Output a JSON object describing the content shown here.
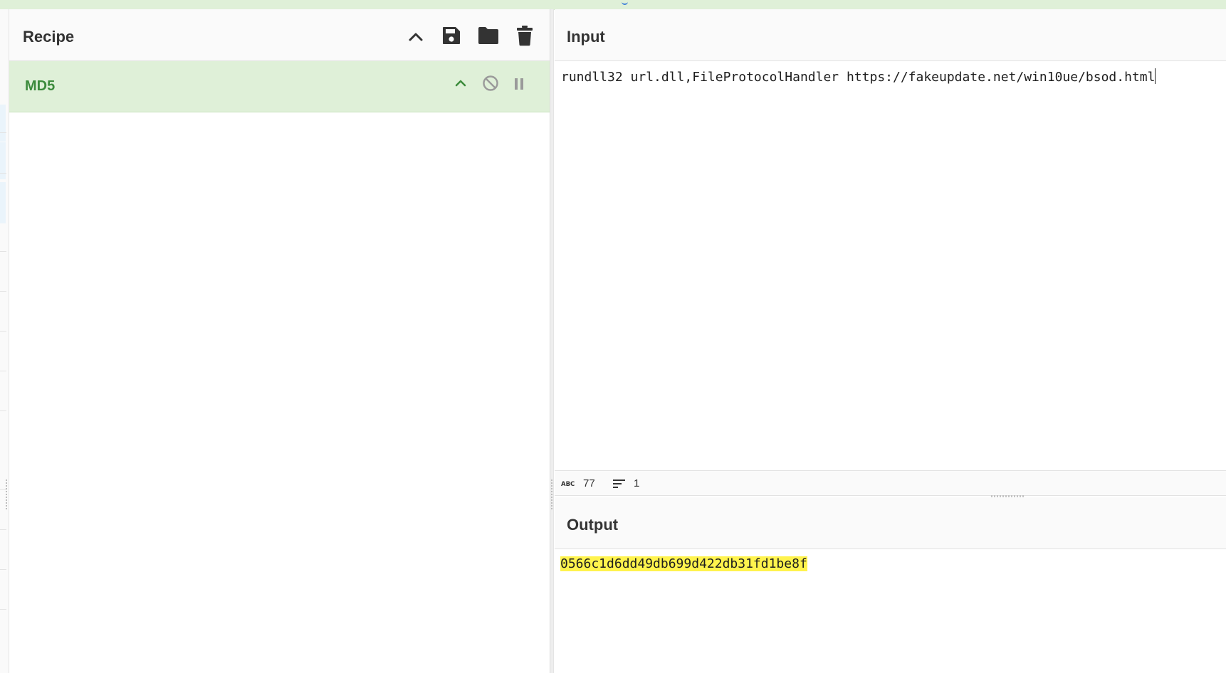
{
  "recipe": {
    "title": "Recipe",
    "operations": [
      {
        "name": "MD5"
      }
    ]
  },
  "input": {
    "title": "Input",
    "value": "rundll32 url.dll,FileProtocolHandler https://fakeupdate.net/win10ue/bsod.html",
    "stats": {
      "length": "77",
      "lines": "1"
    }
  },
  "output": {
    "title": "Output",
    "value": "0566c1d6dd49db699d422db31fd1be8f"
  },
  "icons": {
    "recipe_toolbar": [
      "chevron-up-icon",
      "save-icon",
      "folder-icon",
      "trash-icon"
    ],
    "operation_controls": [
      "chevron-up-icon",
      "disable-icon",
      "pause-icon"
    ],
    "status": [
      "abc-icon",
      "lines-icon"
    ]
  },
  "colors": {
    "operation_bg": "#dff0d8",
    "operation_text": "#3c8b3c",
    "output_highlight": "#fff34d"
  }
}
